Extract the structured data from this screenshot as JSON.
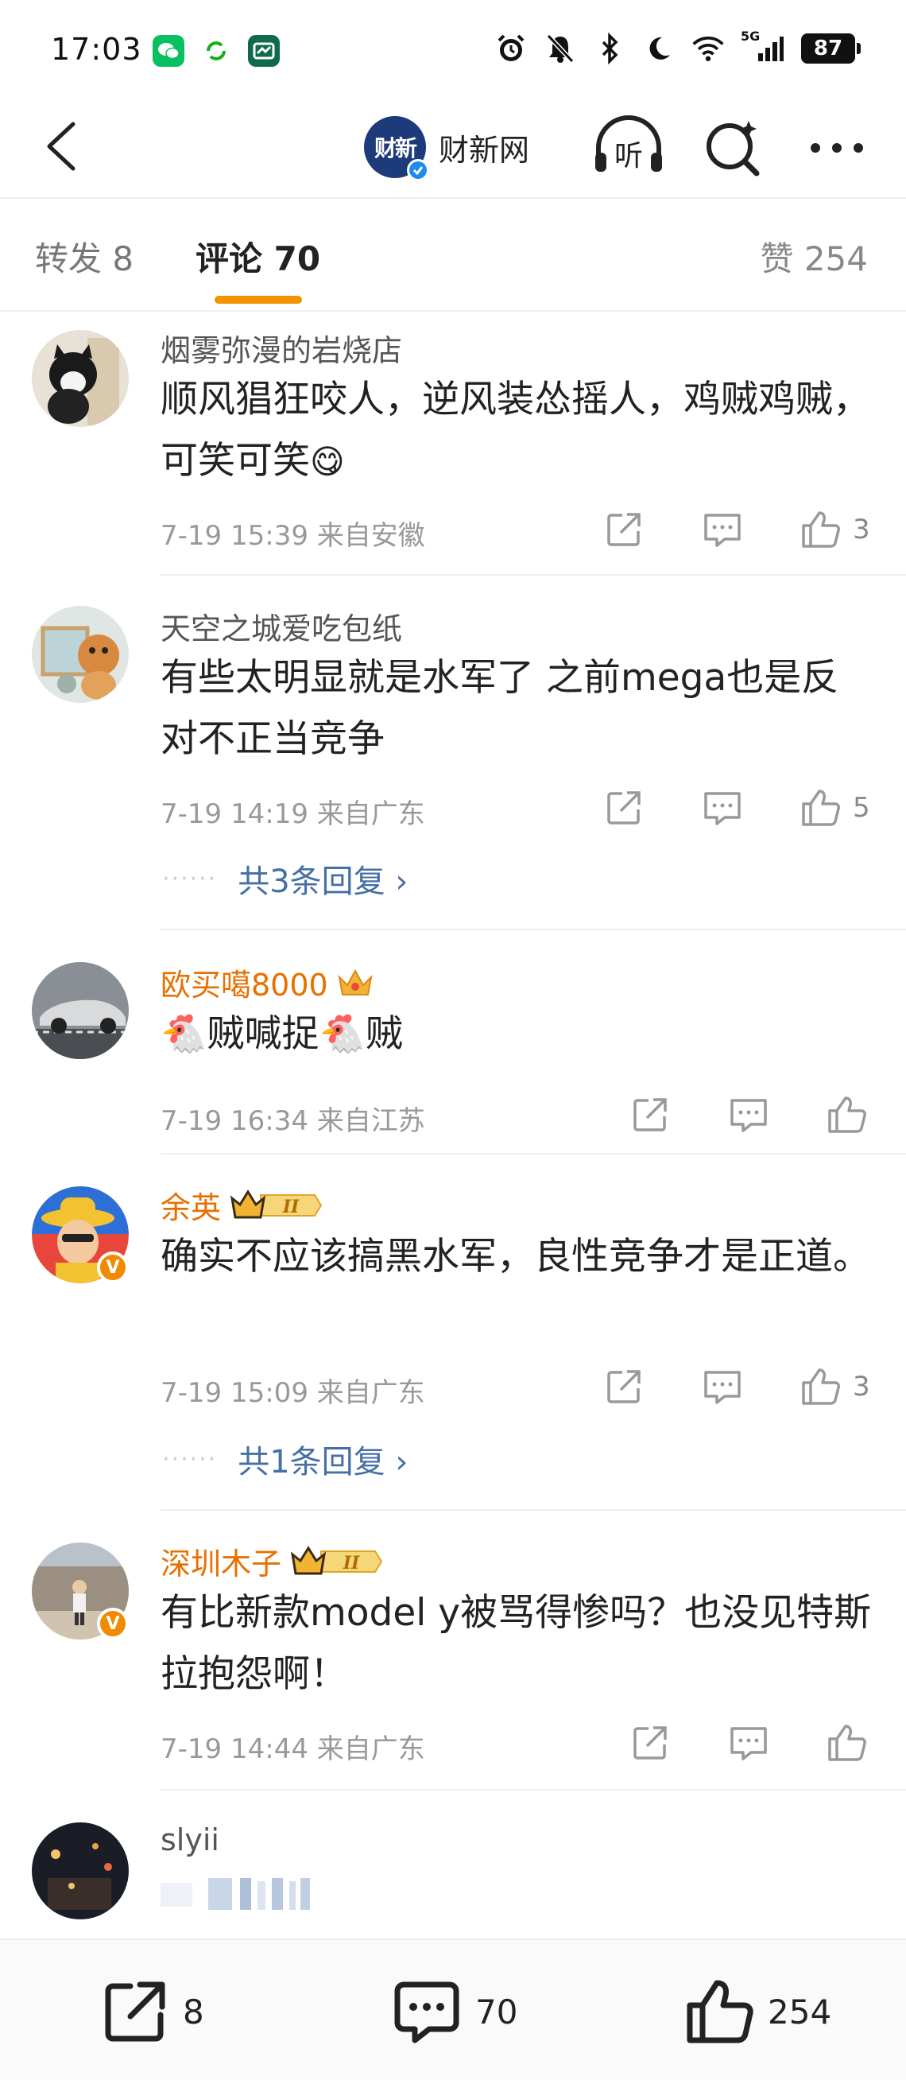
{
  "status_bar": {
    "time": "17:03",
    "network": "5G",
    "battery": "87"
  },
  "nav": {
    "account_name": "财新网",
    "avatar_text": "财新",
    "listen_label": "听"
  },
  "tabs": {
    "repost": "转发 8",
    "comments": "评论 70",
    "likes": "赞 254"
  },
  "comments": [
    {
      "user": "烟雾弥漫的岩烧店",
      "text": "顺风猖狂咬人，逆风装怂摇人，鸡贼鸡贼，可笑可笑",
      "emoji": "😋",
      "meta": "7-19 15:39  来自安徽",
      "likes": "3"
    },
    {
      "user": "天空之城爱吃包纸",
      "text": "有些太明显就是水军了 之前mega也是反对不正当竞争",
      "meta": "7-19 14:19  来自广东",
      "likes": "5",
      "replies": "共3条回复 ›"
    },
    {
      "user": "欧买噶8000",
      "text": "🐔贼喊捉🐔贼",
      "meta": "7-19 16:34  来自江苏",
      "likes": ""
    },
    {
      "user": "余英",
      "text": "确实不应该搞黑水军，良性竞争才是正道。",
      "meta": "7-19 15:09  来自广东",
      "likes": "3",
      "replies": "共1条回复 ›"
    },
    {
      "user": "深圳木子",
      "text": "有比新款model y被骂得惨吗？也没见特斯拉抱怨啊！",
      "meta": "7-19 14:44  来自广东",
      "likes": ""
    },
    {
      "user": "slyii",
      "text": "",
      "meta": "",
      "likes": ""
    }
  ],
  "vip_level": "II",
  "bottom_bar": {
    "repost_count": "8",
    "comment_count": "70",
    "like_count": "254"
  },
  "colors": {
    "accent": "#f29300",
    "link": "#456fa5",
    "vip_name": "#e87000"
  }
}
